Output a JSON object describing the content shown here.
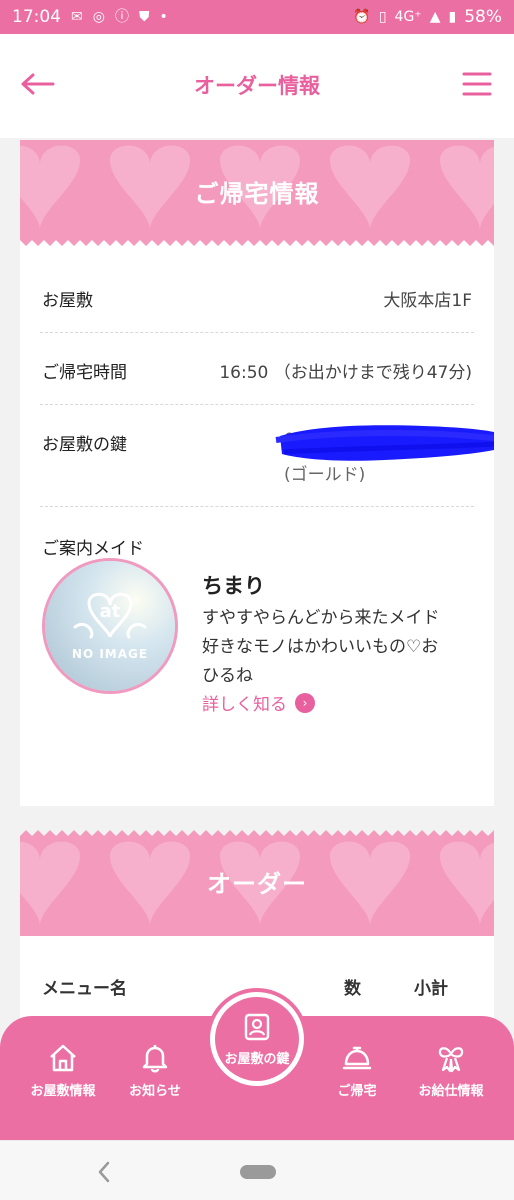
{
  "status_bar": {
    "time": "17:04",
    "network": "4G⁺",
    "battery": "58%"
  },
  "header": {
    "title": "オーダー情報"
  },
  "homecoming": {
    "banner": "ご帰宅情報",
    "rows": [
      {
        "label": "お屋敷",
        "value": "大阪本店1F"
      },
      {
        "label": "ご帰宅時間",
        "value": "16:50 （お出かけまで残り47分)"
      },
      {
        "label": "お屋敷の鍵",
        "value": "000",
        "sub": "(ゴールド)"
      }
    ],
    "maid_section_label": "ご案内メイド",
    "maid": {
      "avatar_mark": "at",
      "avatar_text": "NO IMAGE",
      "name": "ちまり",
      "desc_lines": [
        "すやすやらんどから来たメイド",
        "好きなモノはかわいいもの♡お",
        "ひるね"
      ],
      "more_label": "詳しく知る"
    }
  },
  "order": {
    "banner": "オーダー",
    "col_menu": "メニュー名",
    "col_qty": "数",
    "col_subtotal": "小計"
  },
  "bottom_nav": {
    "items": [
      {
        "label": "お屋敷情報",
        "icon": "house-icon"
      },
      {
        "label": "お知らせ",
        "icon": "bell-icon"
      },
      {
        "label": "ご帰宅",
        "icon": "service-bell-icon"
      },
      {
        "label": "お給仕情報",
        "icon": "ribbon-icon"
      }
    ],
    "center": {
      "label": "お屋敷の鍵",
      "icon": "id-card-icon"
    }
  },
  "colors": {
    "accent": "#ec6fa3",
    "banner_pink": "#f49bbd",
    "link_pink": "#e8609e"
  }
}
